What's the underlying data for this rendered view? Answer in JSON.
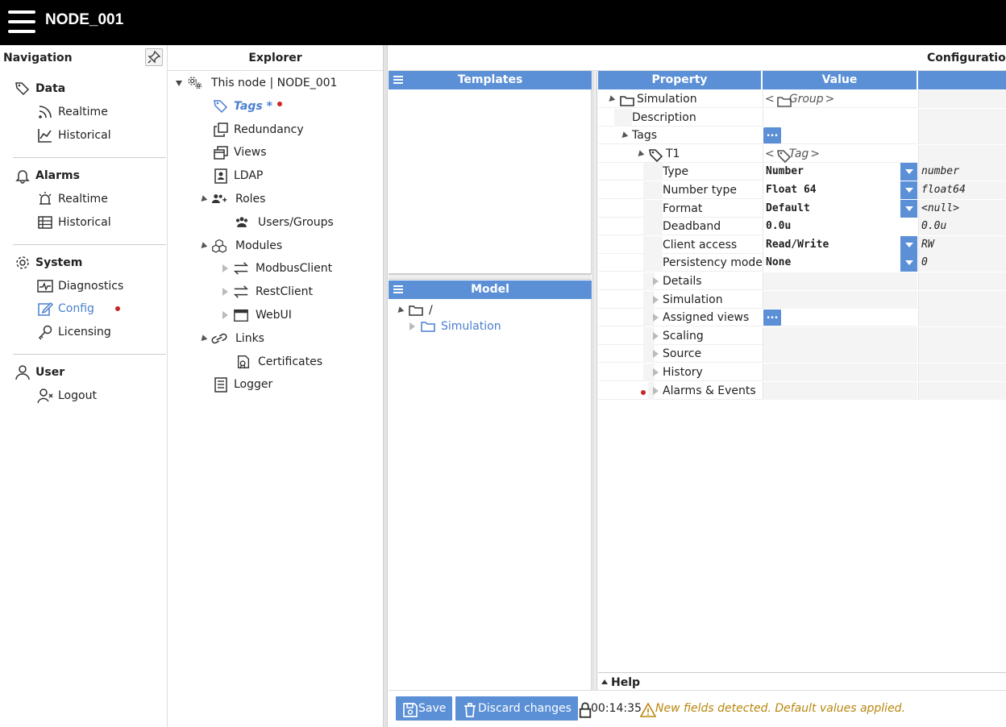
{
  "app": {
    "title": "NODE_001"
  },
  "nav": {
    "title": "Navigation",
    "sections": [
      {
        "label": "Data",
        "items": [
          "Realtime",
          "Historical"
        ]
      },
      {
        "label": "Alarms",
        "items": [
          "Realtime",
          "Historical"
        ]
      },
      {
        "label": "System",
        "items": [
          "Diagnostics",
          "Config",
          "Licensing"
        ]
      },
      {
        "label": "User",
        "items": [
          "Logout"
        ]
      }
    ]
  },
  "explorer": {
    "title": "Explorer",
    "items": {
      "this_node": "This node | NODE_001",
      "tags": "Tags *",
      "redundancy": "Redundancy",
      "views": "Views",
      "ldap": "LDAP",
      "roles": "Roles",
      "users_groups": "Users/Groups",
      "modules": "Modules",
      "modbus": "ModbusClient",
      "rest": "RestClient",
      "webui": "WebUI",
      "links": "Links",
      "certificates": "Certificates",
      "logger": "Logger"
    }
  },
  "config": {
    "title": "Configuration",
    "templates_title": "Templates",
    "model_title": "Model",
    "model_root": "/",
    "model_child": "Simulation",
    "columns": {
      "property": "Property",
      "value": "Value"
    },
    "rows": {
      "simulation": {
        "label": "Simulation",
        "value": "Group"
      },
      "description": {
        "label": "Description"
      },
      "tags": {
        "label": "Tags",
        "value": "..."
      },
      "t1": {
        "label": "T1",
        "value": "Tag"
      },
      "type": {
        "label": "Type",
        "value": "Number",
        "raw": "number"
      },
      "number_type": {
        "label": "Number type",
        "value": "Float 64",
        "raw": "float64"
      },
      "format": {
        "label": "Format",
        "value": "Default",
        "raw": "<null>"
      },
      "deadband": {
        "label": "Deadband",
        "value": "0.0u",
        "raw": "0.0u"
      },
      "client_access": {
        "label": "Client access",
        "value": "Read/Write",
        "raw": "RW"
      },
      "persistency": {
        "label": "Persistency mode",
        "value": "None",
        "raw": "0"
      },
      "details": {
        "label": "Details"
      },
      "sim": {
        "label": "Simulation"
      },
      "assigned_views": {
        "label": "Assigned views",
        "value": "..."
      },
      "scaling": {
        "label": "Scaling"
      },
      "source": {
        "label": "Source"
      },
      "history": {
        "label": "History"
      },
      "alarms": {
        "label": "Alarms & Events"
      }
    },
    "help": "Help"
  },
  "footer": {
    "save": "Save",
    "discard": "Discard changes",
    "time": "00:14:35",
    "warning": "New fields detected. Default values applied."
  },
  "colors": {
    "accent": "#5b8fd6",
    "link": "#4a7fd0",
    "dot": "#c62828",
    "warn": "#b8860b"
  }
}
